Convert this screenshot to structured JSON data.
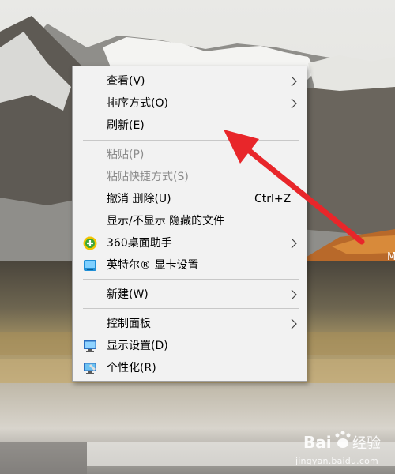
{
  "desktop": {
    "edge_glyph": "M"
  },
  "context_menu": {
    "items": [
      {
        "label": "查看(V)",
        "submenu": true
      },
      {
        "label": "排序方式(O)",
        "submenu": true
      },
      {
        "label": "刷新(E)"
      },
      {
        "label": "粘贴(P)",
        "disabled": true
      },
      {
        "label": "粘贴快捷方式(S)",
        "disabled": true
      },
      {
        "label": "撤消 删除(U)",
        "shortcut": "Ctrl+Z"
      },
      {
        "label": "显示/不显示 隐藏的文件"
      },
      {
        "label": "360桌面助手",
        "icon": "360-assistant-icon",
        "submenu": true
      },
      {
        "label": "英特尔® 显卡设置",
        "icon": "intel-graphics-icon"
      },
      {
        "label": "新建(W)",
        "submenu": true
      },
      {
        "label": "控制面板",
        "submenu": true
      },
      {
        "label": "显示设置(D)",
        "icon": "display-settings-icon"
      },
      {
        "label": "个性化(R)",
        "icon": "personalize-icon"
      }
    ]
  },
  "annotation": {
    "arrow_color": "#e8262a"
  },
  "watermark": {
    "logo_text": "Bai经验",
    "url": "jingyan.baidu.com"
  }
}
